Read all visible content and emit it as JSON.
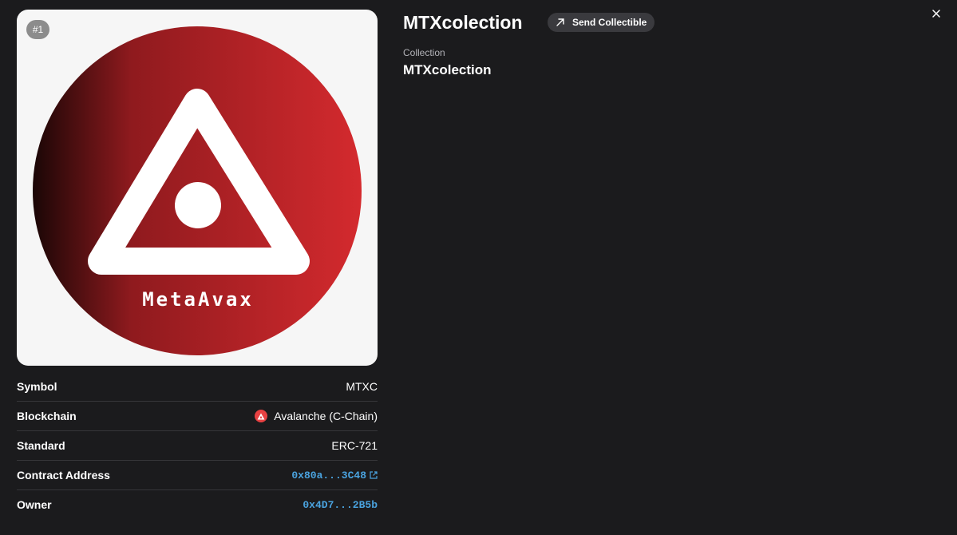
{
  "header": {
    "title": "MTXcolection",
    "send_label": "Send Collectible",
    "close_icon": "close-icon"
  },
  "collection": {
    "caption": "Collection",
    "name": "MTXcolection"
  },
  "image": {
    "badge": "#1",
    "logo_text": "MetaAvax",
    "colors": {
      "background": "#f6f6f6",
      "circle_dark": "#1a0606",
      "circle_mid": "#8f1a1e",
      "circle_light": "#d42a2e",
      "logo_white": "#ffffff"
    }
  },
  "details": {
    "symbol": {
      "label": "Symbol",
      "value": "MTXC"
    },
    "blockchain": {
      "label": "Blockchain",
      "value": "Avalanche (C-Chain)",
      "icon": "avalanche-icon"
    },
    "standard": {
      "label": "Standard",
      "value": "ERC-721"
    },
    "contract": {
      "label": "Contract Address",
      "value": "0x80a...3C48",
      "icon": "external-link-icon"
    },
    "owner": {
      "label": "Owner",
      "value": "0x4D7...2B5b"
    }
  },
  "colors": {
    "page_background": "#1b1b1d",
    "link": "#4aa3df",
    "divider": "#36363a",
    "button_background": "#3a3a3e"
  }
}
